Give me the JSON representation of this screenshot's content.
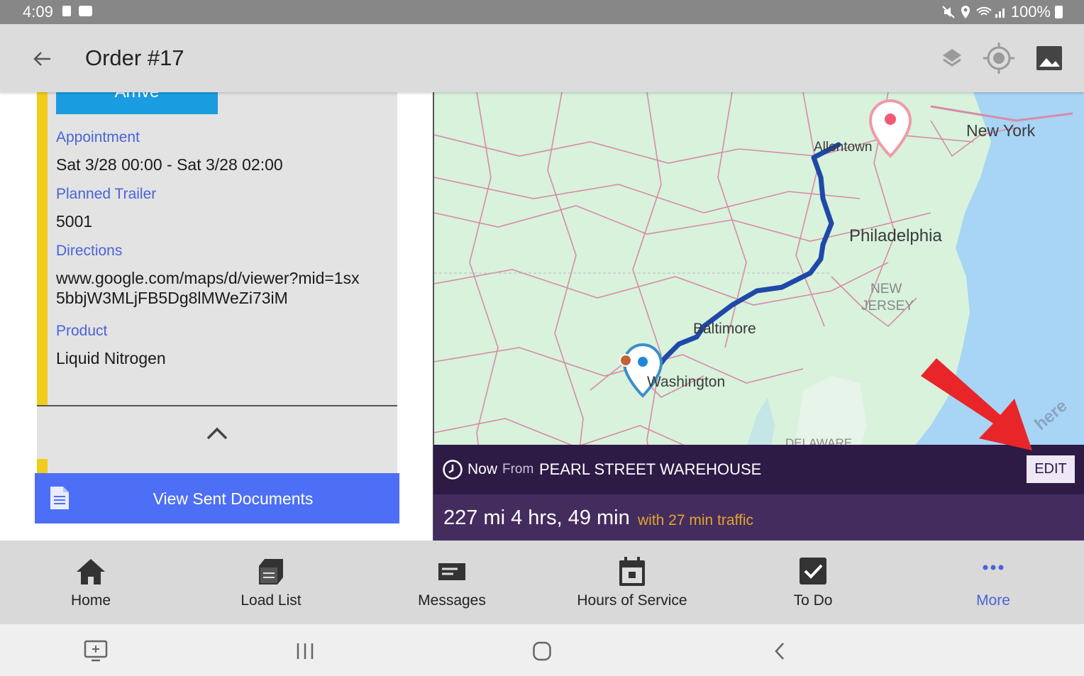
{
  "status_bar": {
    "time": "4:09",
    "battery": "100%"
  },
  "app_bar": {
    "title": "Order #17",
    "icons": [
      "back-arrow-icon",
      "layers-icon",
      "my-location-icon",
      "image-icon"
    ]
  },
  "stop_details": {
    "arrive_button": "Arrive",
    "fields": [
      {
        "label": "Appointment",
        "value": "Sat 3/28 00:00 - Sat 3/28 02:00"
      },
      {
        "label": "Planned Trailer",
        "value": "5001"
      },
      {
        "label": "Directions",
        "value": "www.google.com/maps/d/viewer?mid=1sx5bbjW3MLjFB5Dg8lMWeZi73iM"
      },
      {
        "label": "Product",
        "value": "Liquid Nitrogen"
      }
    ],
    "view_sent_documents": "View Sent Documents"
  },
  "map": {
    "place_labels": {
      "new_york": "New York",
      "allentown": "Allentown",
      "philadelphia": "Philadelphia",
      "new_jersey_1": "NEW",
      "new_jersey_2": "JERSEY",
      "baltimore": "Baltimore",
      "washington": "Washington",
      "delaware": "DELAWARE",
      "attribution": "here"
    },
    "colors": {
      "land": "#d8f2dc",
      "water": "#a8d4f5",
      "route": "#1f48a8",
      "roads": "#d98aa8"
    }
  },
  "route_info": {
    "time_prefix": "Now",
    "from_label": "From",
    "origin": "PEARL STREET WAREHOUSE",
    "edit_button": "EDIT",
    "distance_time": "227 mi 4 hrs, 49 min",
    "traffic": "with 27 min traffic"
  },
  "bottom_nav": {
    "items": [
      {
        "label": "Home",
        "icon": "home-icon"
      },
      {
        "label": "Load List",
        "icon": "load-list-icon"
      },
      {
        "label": "Messages",
        "icon": "messages-icon"
      },
      {
        "label": "Hours of Service",
        "icon": "calendar-icon"
      },
      {
        "label": "To Do",
        "icon": "checkbox-icon"
      },
      {
        "label": "More",
        "icon": "more-dots-icon"
      }
    ],
    "active_color": "#4a63d6"
  },
  "system_nav": {
    "icons": [
      "screen-icon",
      "recents-icon",
      "home-circle-icon",
      "back-chevron-icon"
    ]
  }
}
